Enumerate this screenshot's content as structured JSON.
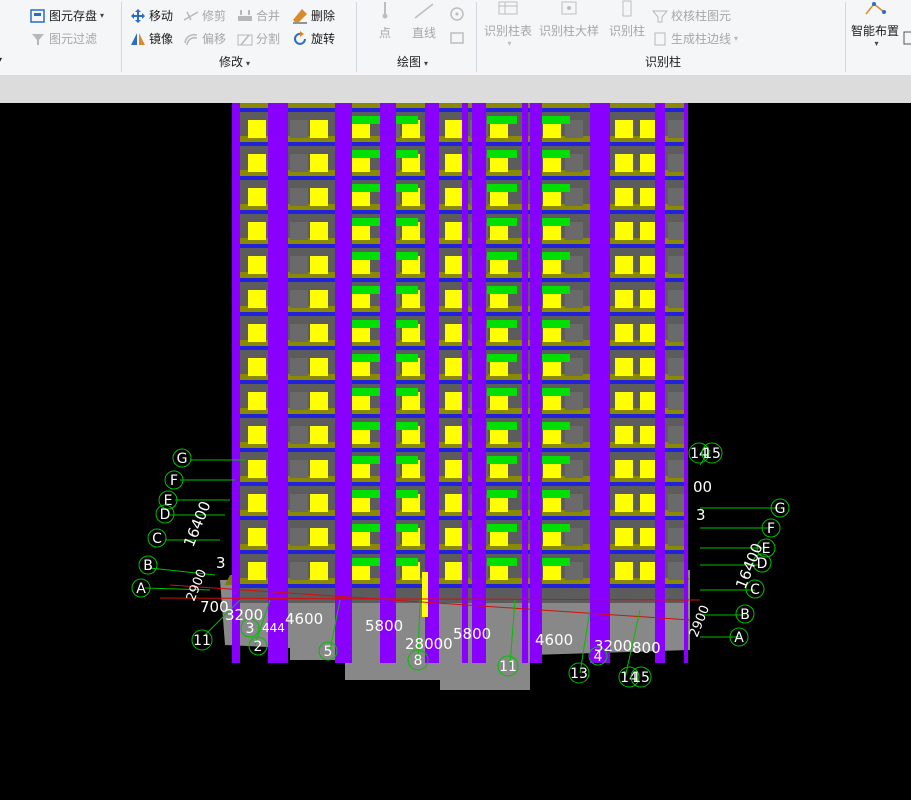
{
  "ribbon": {
    "tool_items": {
      "save_element": "图元存盘",
      "filter_element": "图元过滤",
      "move": "移动",
      "trim": "修剪",
      "merge": "合并",
      "delete": "删除",
      "mirror": "镜像",
      "offset": "偏移",
      "split": "分割",
      "rotate": "旋转",
      "point": "点",
      "line": "直线",
      "identify_column_table": "识别柱表",
      "identify_column_detail": "识别柱大样",
      "identify_column": "识别柱",
      "check_column": "校核柱图元",
      "gen_column_edge": "生成柱边线",
      "smart_layout": "智能布置"
    },
    "groups": {
      "modify": "修改",
      "draw": "绘图",
      "identify_column": "识别柱"
    }
  },
  "viewport": {
    "axis_labels_left": [
      "G",
      "F",
      "E",
      "D",
      "C",
      "B",
      "A"
    ],
    "axis_labels_right": [
      "G",
      "F",
      "E",
      "D",
      "C",
      "B",
      "A"
    ],
    "axis_numbers_bottom": [
      "11",
      "3",
      "2",
      "5",
      "8",
      "11",
      "13",
      "4",
      "14",
      "15"
    ],
    "axis_numbers_top_right": [
      "14",
      "15"
    ],
    "dimensions": {
      "d700": "700",
      "d3200_left": "3200",
      "d444": "444",
      "d4600_left": "4600",
      "d5800_left": "5800",
      "d28000": "28000",
      "d5800_right": "5800",
      "d4600_right": "4600",
      "d3200_right": "3200",
      "d800": "800",
      "d16400_left": "16400",
      "d16400_right": "16400",
      "d2900_left": "2900",
      "d2900_right": "2900",
      "d00": "00",
      "d3": "3",
      "d3_tr": "3"
    }
  },
  "colors": {
    "column": "#8a00ff",
    "window": "#ffff00",
    "beam": "#808000",
    "slab": "#00e000",
    "wall": "#5a5a5a",
    "lintel": "#2020e0"
  }
}
